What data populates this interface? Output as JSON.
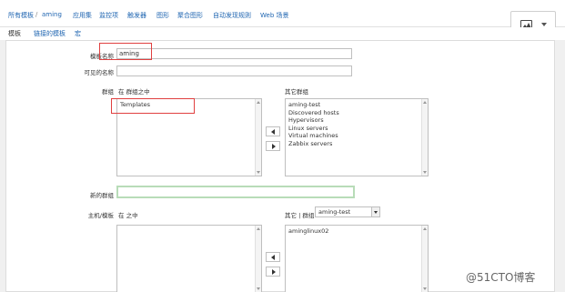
{
  "breadcrumb": {
    "all_templates": "所有模板",
    "separator": "/",
    "current": "aming",
    "links": [
      "应用集",
      "监控项",
      "触发器",
      "图形",
      "聚合图形",
      "自动发现规则",
      "Web 场景"
    ]
  },
  "tabs": [
    "模板",
    "链接的模板",
    "宏"
  ],
  "form": {
    "template_name_label": "模板名称",
    "template_name_value": "aming",
    "visible_name_label": "可见的名称",
    "visible_name_value": "",
    "groups_label": "群组",
    "groups_in_label": "在 群组之中",
    "groups_in": [
      "Templates"
    ],
    "other_groups_label": "其它群组",
    "other_groups": [
      "aming-test",
      "Discovered hosts",
      "Hypervisors",
      "Linux servers",
      "Virtual machines",
      "Zabbix servers"
    ],
    "new_group_label": "新的群组",
    "new_group_value": "",
    "hosts_label": "主机/模板",
    "hosts_in_label": "在 之中",
    "hosts_in": [],
    "other_hosts_label": "其它 | 群组",
    "other_hosts_group_select": "aming-test",
    "other_hosts": [
      "aminglinux02"
    ]
  },
  "watermark": "@51CTO博客",
  "colors": {
    "link": "#1f65b1",
    "highlight_box": "#e04040",
    "new_group_border": "#b8dcb8"
  }
}
